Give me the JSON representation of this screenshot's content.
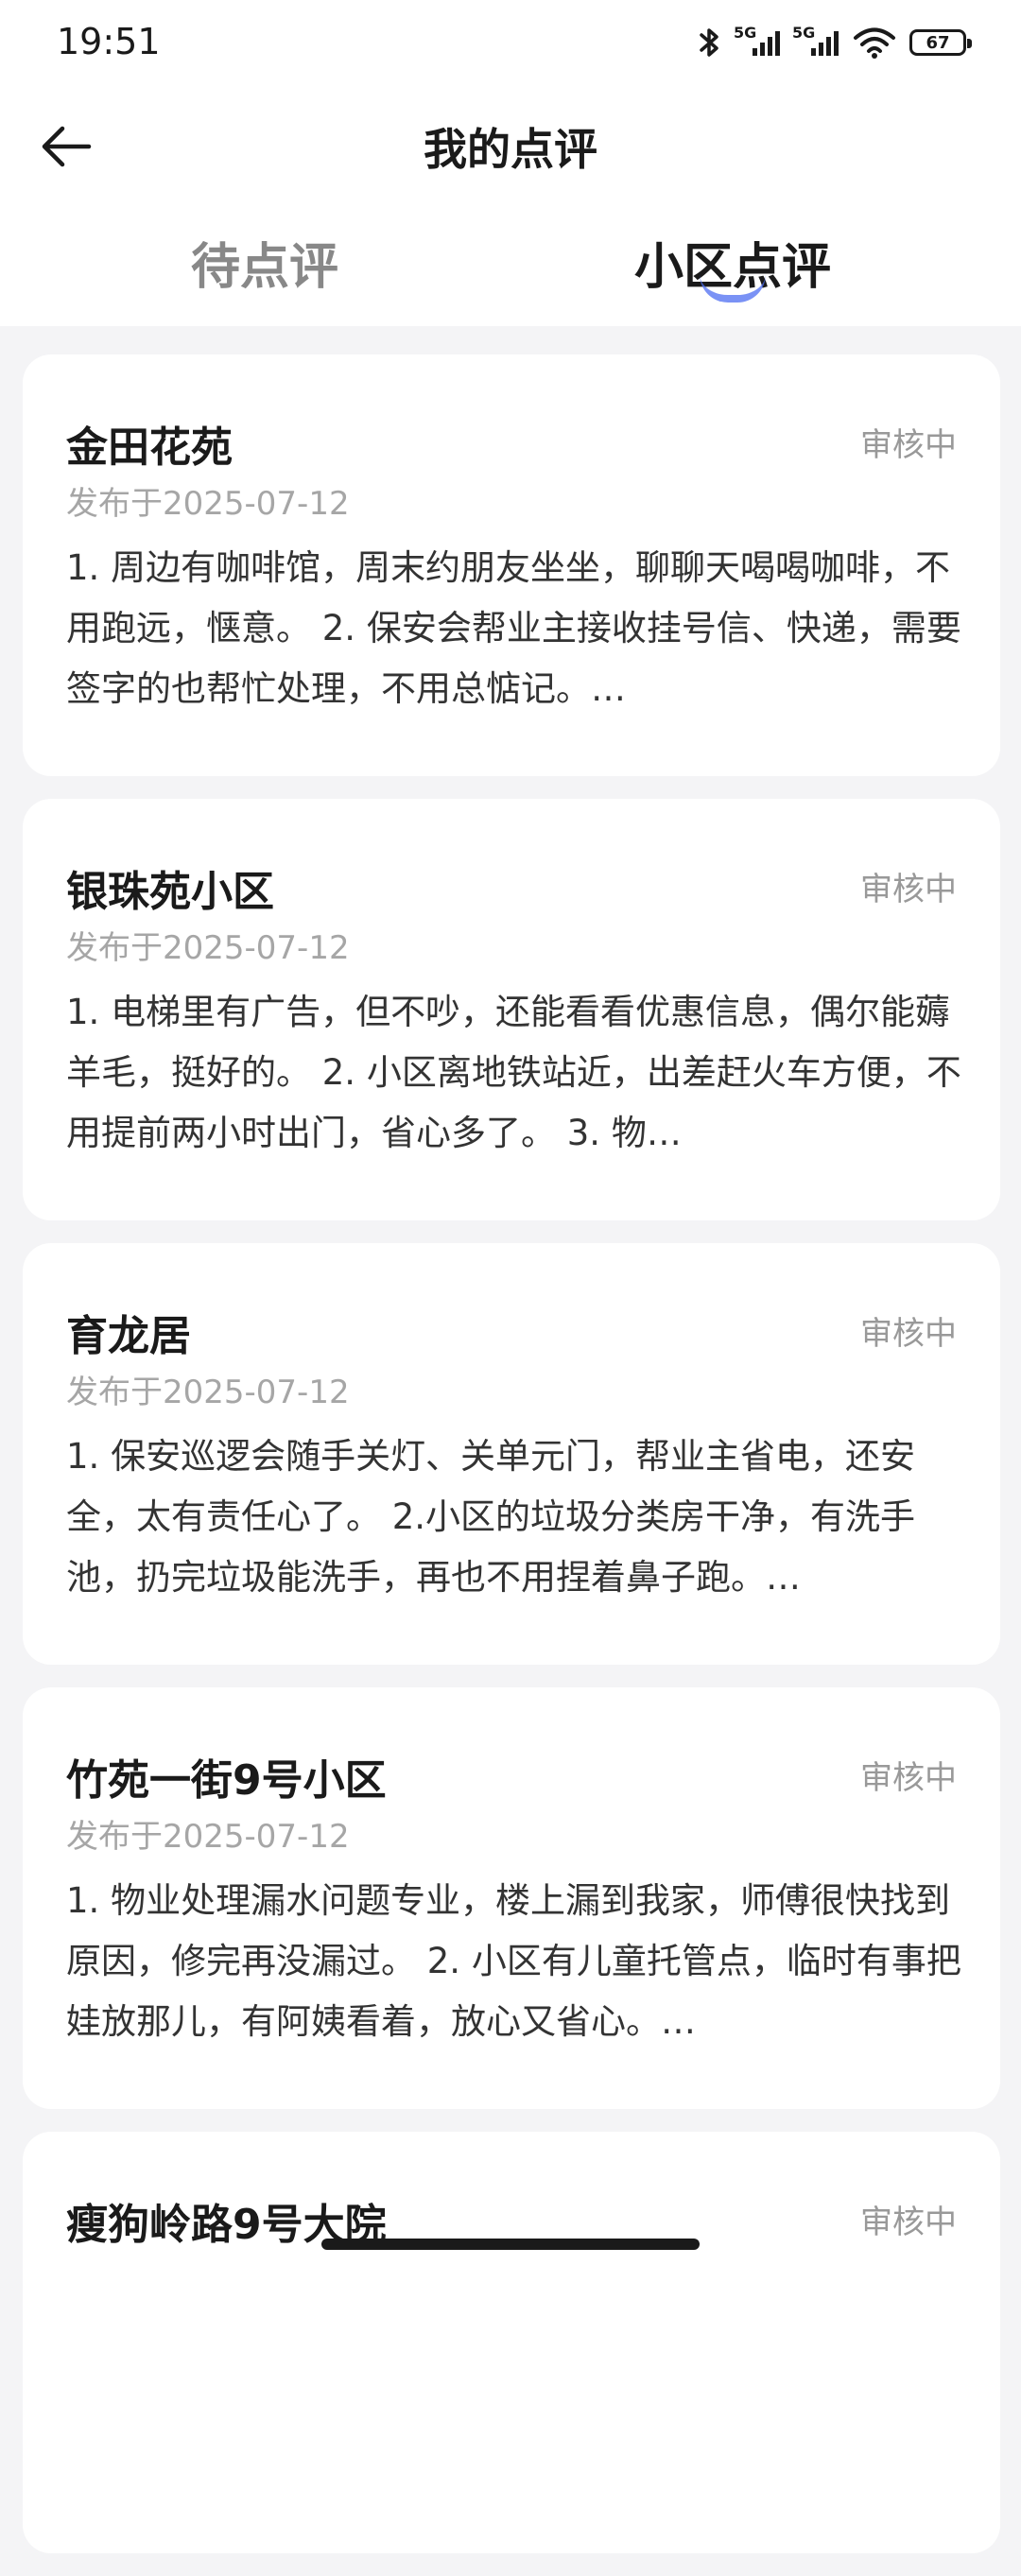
{
  "status_bar": {
    "time": "19:51",
    "signal1_label": "5G",
    "signal2_label": "5G",
    "battery": "67"
  },
  "header": {
    "title": "我的点评"
  },
  "tabs": [
    {
      "label": "待点评",
      "active": false
    },
    {
      "label": "小区点评",
      "active": true
    }
  ],
  "reviews": [
    {
      "name": "金田花苑",
      "status": "审核中",
      "date": "发布于2025-07-12",
      "text": "1. 周边有咖啡馆，周末约朋友坐坐，聊聊天喝喝咖啡，不用跑远，惬意。 2. 保安会帮业主接收挂号信、快递，需要签字的也帮忙处理，不用总惦记。…"
    },
    {
      "name": "银珠苑小区",
      "status": "审核中",
      "date": "发布于2025-07-12",
      "text": "1. 电梯里有广告，但不吵，还能看看优惠信息，偶尔能薅羊毛，挺好的。 2. 小区离地铁站近，出差赶火车方便，不用提前两小时出门，省心多了。 3. 物…"
    },
    {
      "name": "育龙居",
      "status": "审核中",
      "date": "发布于2025-07-12",
      "text": "1. 保安巡逻会随手关灯、关单元门，帮业主省电，还安全，太有责任心了。 2.小区的垃圾分类房干净，有洗手池，扔完垃圾能洗手，再也不用捏着鼻子跑。…"
    },
    {
      "name": "竹苑一街9号小区",
      "status": "审核中",
      "date": "发布于2025-07-12",
      "text": "1. 物业处理漏水问题专业，楼上漏到我家，师傅很快找到原因，修完再没漏过。 2. 小区有儿童托管点，临时有事把娃放那儿，有阿姨看着，放心又省心。…"
    },
    {
      "name": "瘦狗岭路9号大院",
      "status": "审核中",
      "date": "",
      "text": ""
    }
  ]
}
